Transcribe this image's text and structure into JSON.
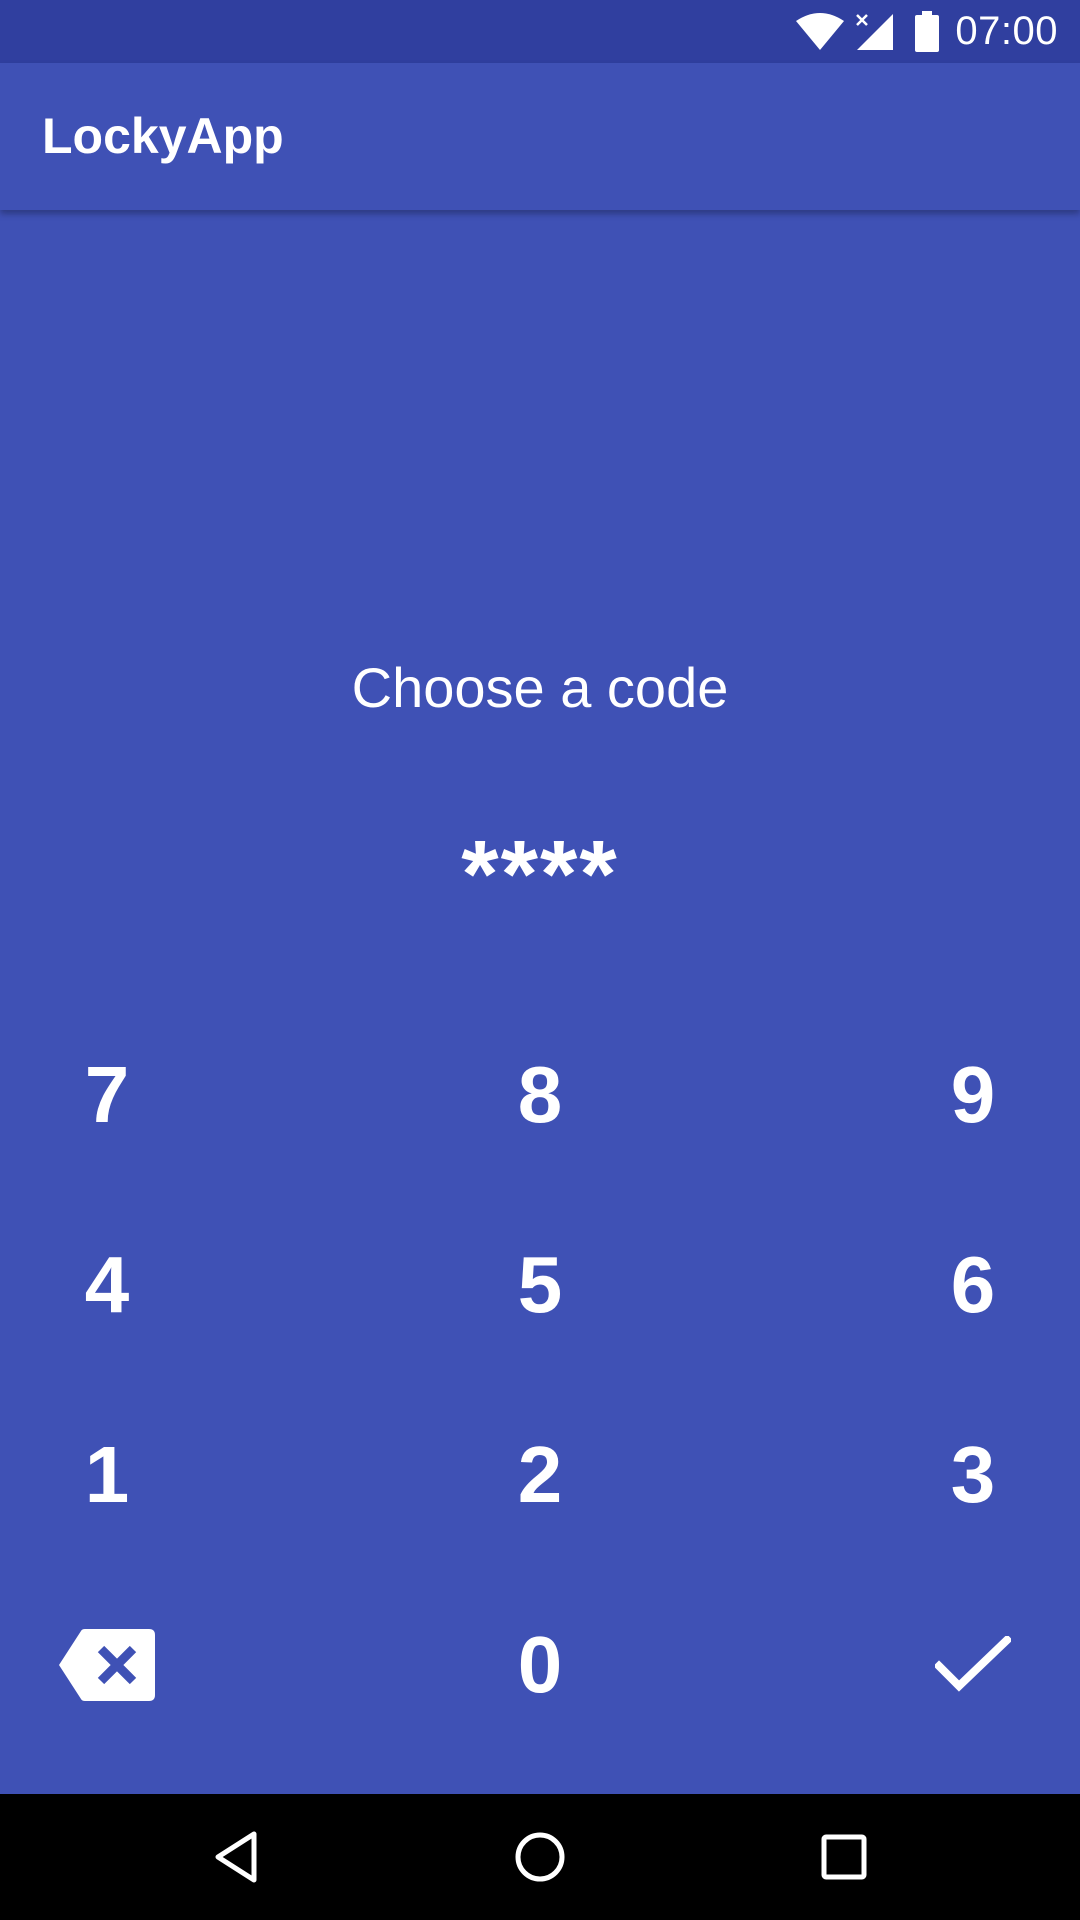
{
  "status_bar": {
    "time": "07:00",
    "icons": [
      "wifi-icon",
      "no-signal-icon",
      "battery-icon"
    ]
  },
  "app_bar": {
    "title": "LockyApp"
  },
  "lock_screen": {
    "prompt": "Choose a code",
    "code_display": "****"
  },
  "keypad": {
    "keys": [
      "7",
      "8",
      "9",
      "4",
      "5",
      "6",
      "1",
      "2",
      "3",
      "backspace-icon",
      "0",
      "checkmark-icon"
    ]
  },
  "nav_bar": {
    "buttons": [
      "back-icon",
      "home-icon",
      "recents-icon"
    ]
  },
  "colors": {
    "primary": "#3F51B5",
    "primary_dark": "#303F9F",
    "text": "#FFFFFF",
    "nav_bar": "#000000"
  }
}
